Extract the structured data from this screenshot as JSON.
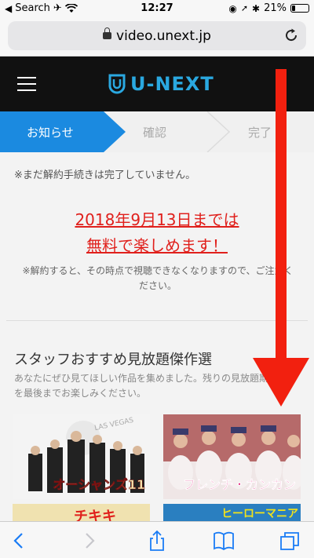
{
  "status_bar": {
    "carrier": "Search",
    "time": "12:27",
    "battery": "21%",
    "battery_level": 0.21
  },
  "browser": {
    "url": "video.unext.jp"
  },
  "site": {
    "logo_text": "U-NEXT"
  },
  "steps": [
    {
      "label": "お知らせ"
    },
    {
      "label": "確認"
    },
    {
      "label": "完了"
    }
  ],
  "content": {
    "notice": "※まだ解約手続きは完了していません。",
    "promo_line1": "2018年9月13日までは",
    "promo_line2": "無料で楽しめます！",
    "footnote_line1": "※解約すると、その時点で視聴できなくなりますので、ご注意く",
    "footnote_line2": "ださい。",
    "section_title": "スタッフおすすめ見放題傑作選",
    "section_desc_line1": "あなたにぜひ見てほしい作品を集めました。残りの見放題期間",
    "section_desc_line2": "を最後までお楽しみください。"
  },
  "recommendations": [
    {
      "title": "オーシャンズ11",
      "sign": "LAS VEGAS"
    },
    {
      "title": "フレンチ・カンカン"
    },
    {
      "title": "チキキ"
    },
    {
      "title": "ヒーローマニア"
    }
  ],
  "colors": {
    "accent_blue": "#1b8ae0",
    "promo_red": "#e0201c",
    "arrow_red": "#f2200f",
    "header_black": "#111111",
    "logo_blue": "#2aa8e0"
  },
  "icons": [
    "airplane-icon",
    "wifi-icon",
    "lock-icon",
    "reload-icon",
    "hamburger-icon",
    "back-icon",
    "forward-icon",
    "share-icon",
    "bookmarks-icon",
    "tabs-icon"
  ]
}
